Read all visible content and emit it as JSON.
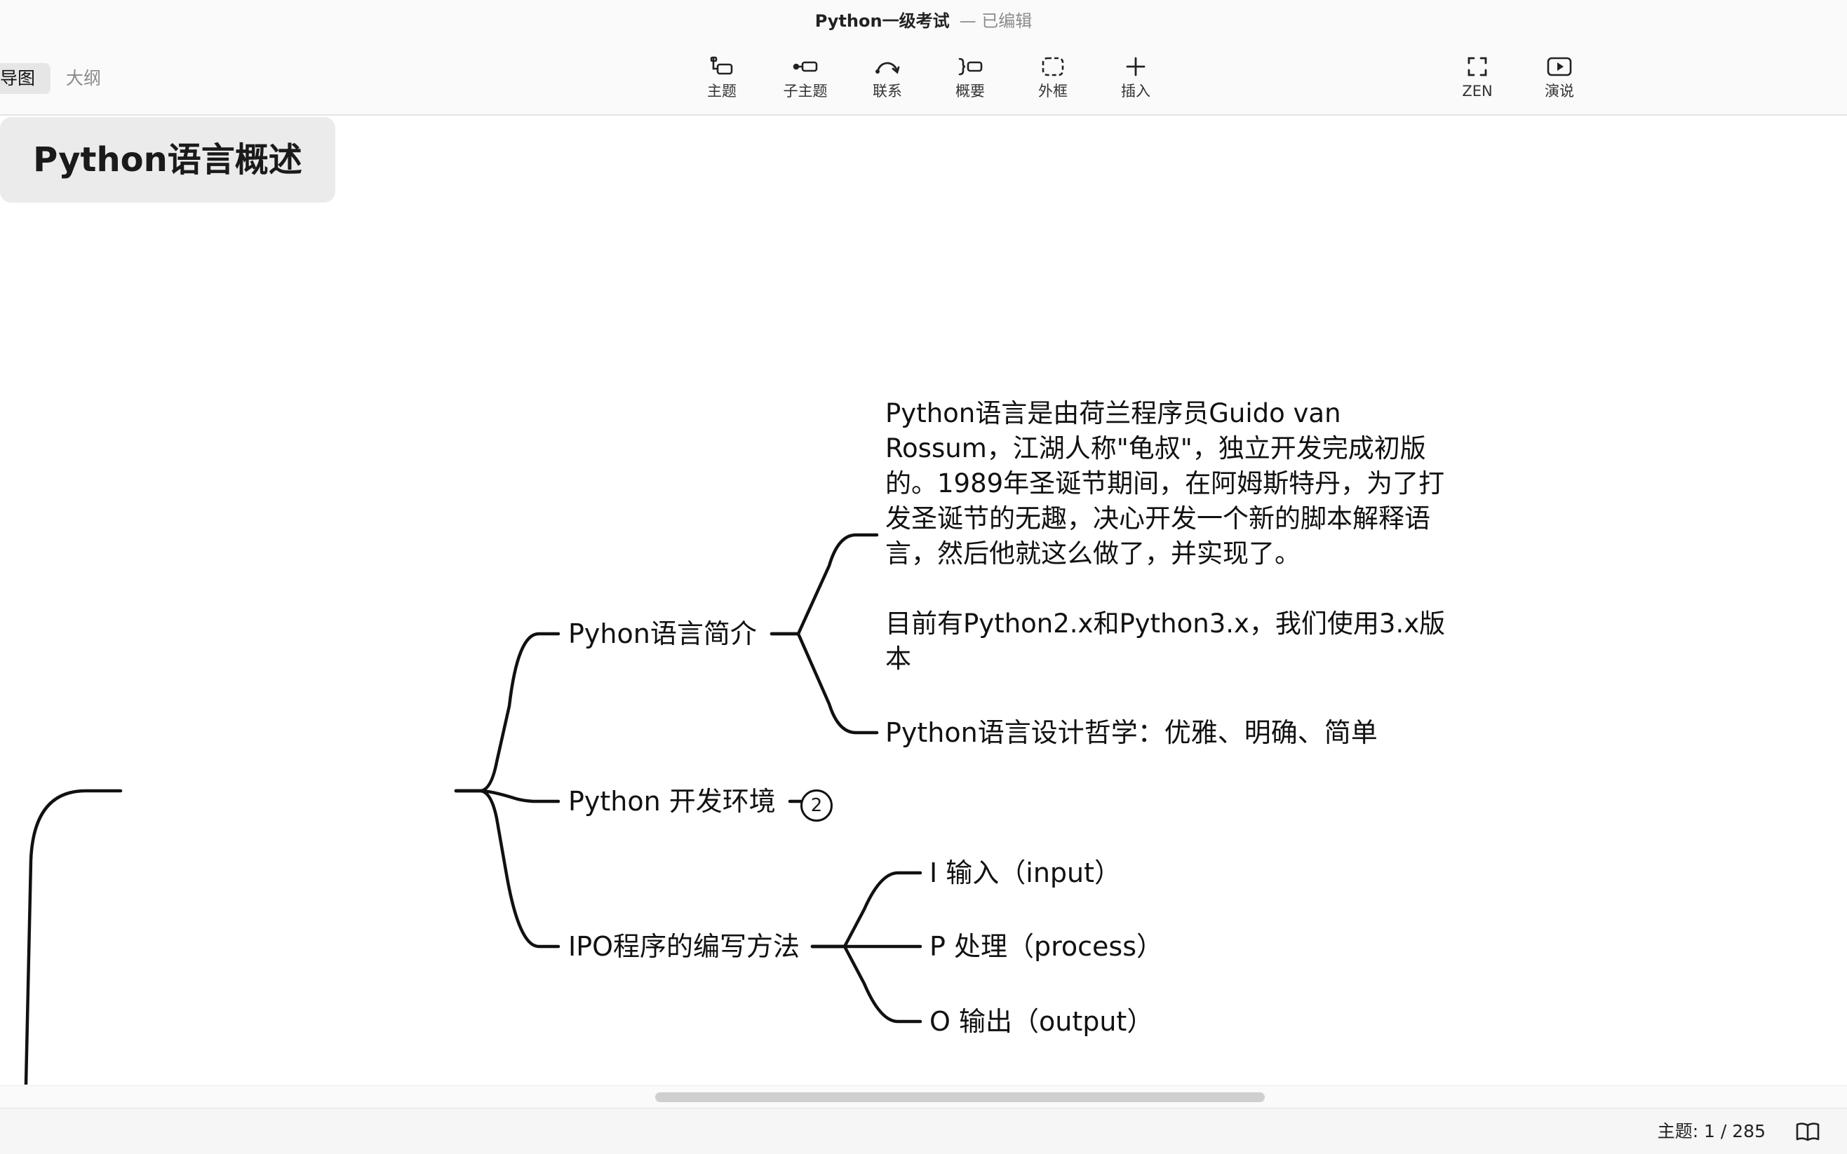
{
  "window": {
    "title": "Python一级考试",
    "status": "— 已编辑"
  },
  "view_switch": {
    "mindmap_label": "导图",
    "outline_label": "大纲"
  },
  "toolbar": {
    "items": [
      {
        "label": "主题",
        "icon": "topic-icon"
      },
      {
        "label": "子主题",
        "icon": "subtopic-icon"
      },
      {
        "label": "联系",
        "icon": "relationship-icon"
      },
      {
        "label": "概要",
        "icon": "summary-icon"
      },
      {
        "label": "外框",
        "icon": "boundary-icon"
      },
      {
        "label": "插入",
        "icon": "plus-icon"
      }
    ],
    "right_items": [
      {
        "label": "ZEN",
        "icon": "zen-fullscreen-icon"
      },
      {
        "label": "演说",
        "icon": "present-play-icon"
      }
    ]
  },
  "mindmap": {
    "central": "Python语言概述",
    "branches": [
      {
        "label": "Pyhon语言简介",
        "children": [
          "Python语言是由荷兰程序员Guido van Rossum，江湖人称\"龟叔\"，独立开发完成初版的。1989年圣诞节期间，在阿姆斯特丹，为了打发圣诞节的无趣，决心开发一个新的脚本解释语言，然后他就这么做了，并实现了。\n\n目前有Python2.x和Python3.x，我们使用3.x版本",
          "Python语言设计哲学：优雅、明确、简单"
        ]
      },
      {
        "label": "Python 开发环境",
        "collapsed_count": "2"
      },
      {
        "label": "IPO程序的编写方法",
        "children": [
          "I 输入（input）",
          "P 处理（process）",
          "O 输出（output）"
        ]
      }
    ]
  },
  "status": {
    "topic_count": "主题: 1 / 285",
    "icon": "book-open-icon"
  },
  "colors": {
    "line": "#111111",
    "central_fill": "#ebebeb",
    "toolbar_bg": "#fafafa"
  }
}
